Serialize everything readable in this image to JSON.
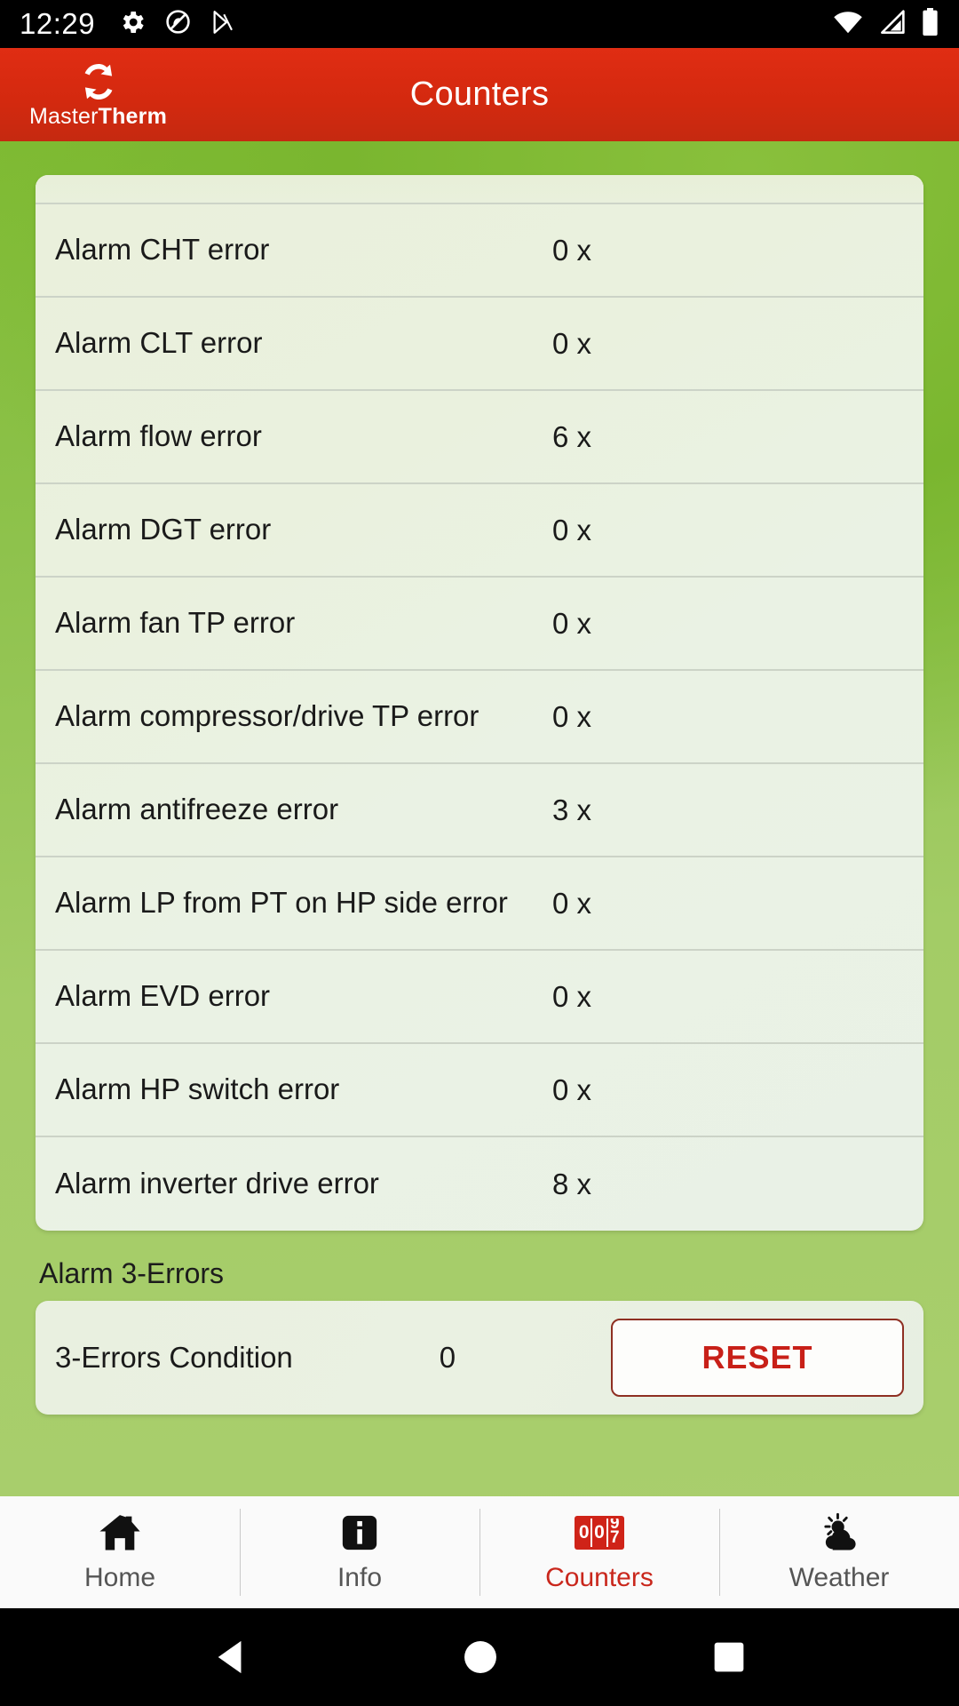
{
  "status_bar": {
    "time": "12:29",
    "left_icons": [
      "settings-gear-icon",
      "no-sound-icon",
      "play-store-icon"
    ],
    "right_icons": [
      "wifi-icon",
      "cellular-signal-icon",
      "battery-icon"
    ]
  },
  "app_bar": {
    "brand_first": "Master",
    "brand_second": "Therm",
    "logo_icon": "refresh-circular-arrows-icon",
    "title": "Counters",
    "accent_color": "#d4290f"
  },
  "counters": {
    "rows": [
      {
        "label": "Alarm CHT error",
        "value": "0 x"
      },
      {
        "label": "Alarm CLT error",
        "value": "0 x"
      },
      {
        "label": "Alarm flow error",
        "value": "6 x"
      },
      {
        "label": "Alarm DGT error",
        "value": "0 x"
      },
      {
        "label": "Alarm fan TP error",
        "value": "0 x"
      },
      {
        "label": "Alarm compressor/drive TP error",
        "value": "0 x"
      },
      {
        "label": "Alarm antifreeze error",
        "value": "3 x"
      },
      {
        "label": "Alarm LP from PT on HP side error",
        "value": "0 x"
      },
      {
        "label": "Alarm EVD error",
        "value": "0 x"
      },
      {
        "label": "Alarm HP switch error",
        "value": "0 x"
      },
      {
        "label": "Alarm inverter drive error",
        "value": "8 x"
      }
    ]
  },
  "three_errors": {
    "section_title": "Alarm 3-Errors",
    "label": "3-Errors Condition",
    "value": "0",
    "reset_label": "RESET",
    "reset_color": "#c82018"
  },
  "bottom_nav": {
    "active_color": "#c9271c",
    "inactive_color": "#555555",
    "items": [
      {
        "label": "Home",
        "icon": "home-icon",
        "active": false
      },
      {
        "label": "Info",
        "icon": "info-icon",
        "active": false
      },
      {
        "label": "Counters",
        "icon": "odometer-counter-icon",
        "active": true
      },
      {
        "label": "Weather",
        "icon": "sun-cloud-icon",
        "active": false
      }
    ]
  },
  "system_nav": {
    "back": "back-triangle-icon",
    "home": "home-circle-icon",
    "recents": "recents-square-icon"
  }
}
